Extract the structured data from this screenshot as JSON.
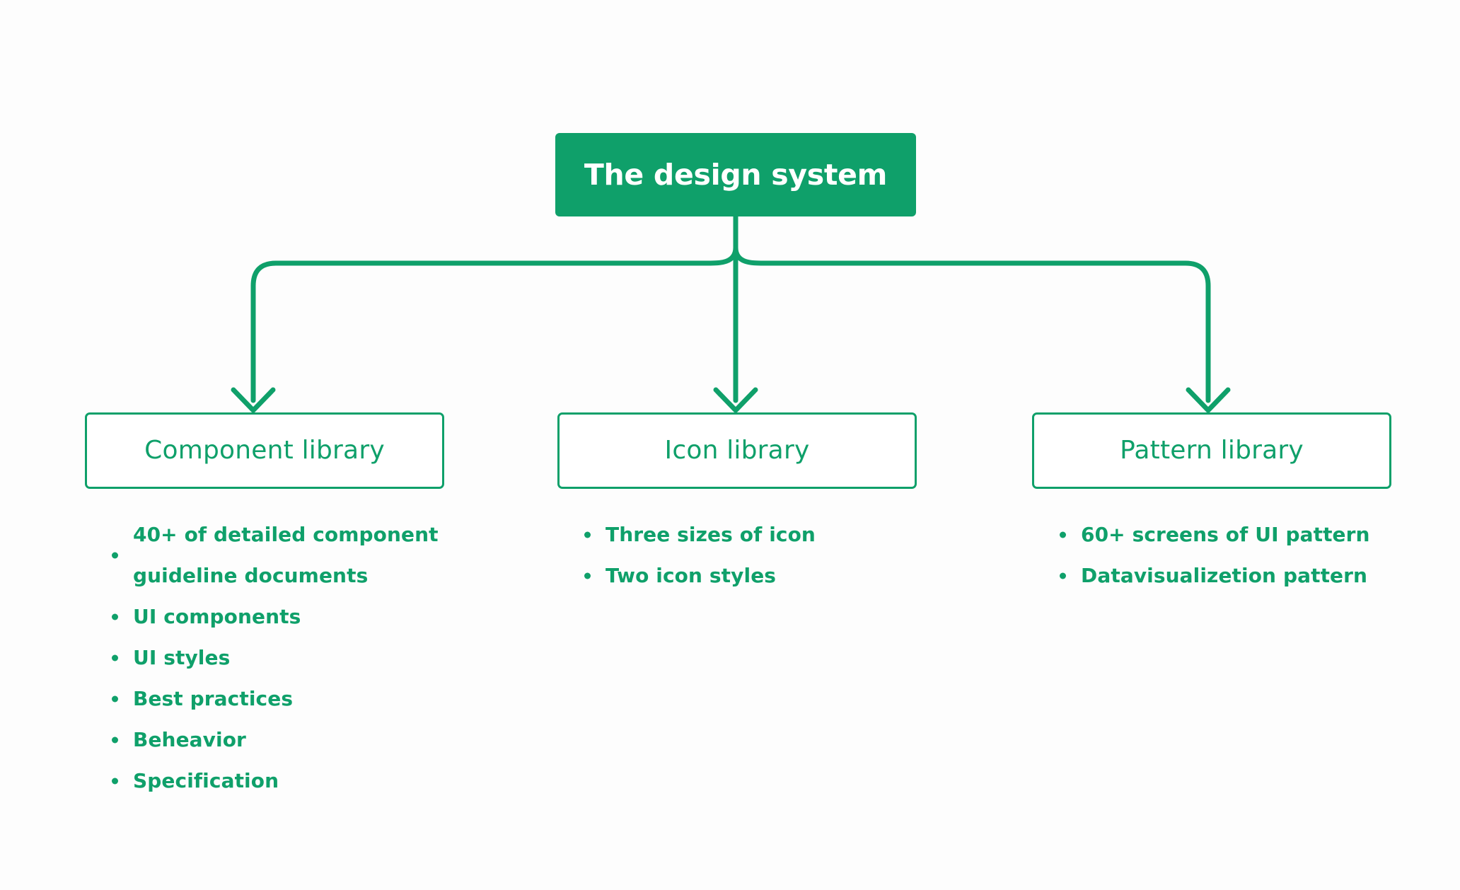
{
  "diagram": {
    "type": "tree-hierarchy",
    "colors": {
      "accent": "#0fa06a",
      "node_fill": "#0fa06a",
      "node_text_on_fill": "#ffffff",
      "outline_node_text": "#0fa06a",
      "background": "#fdfdfd",
      "bullet_text": "#0fa06a"
    },
    "root": {
      "label": "The design system"
    },
    "children": [
      {
        "label": "Component library",
        "bullets": [
          "40+ of detailed component guideline documents",
          "UI components",
          "UI styles",
          "Best practices",
          "Beheavior",
          "Specification"
        ]
      },
      {
        "label": "Icon library",
        "bullets": [
          "Three sizes of icon",
          "Two icon styles"
        ]
      },
      {
        "label": "Pattern library",
        "bullets": [
          "60+ screens of UI pattern",
          "Datavisualizetion pattern"
        ]
      }
    ]
  }
}
